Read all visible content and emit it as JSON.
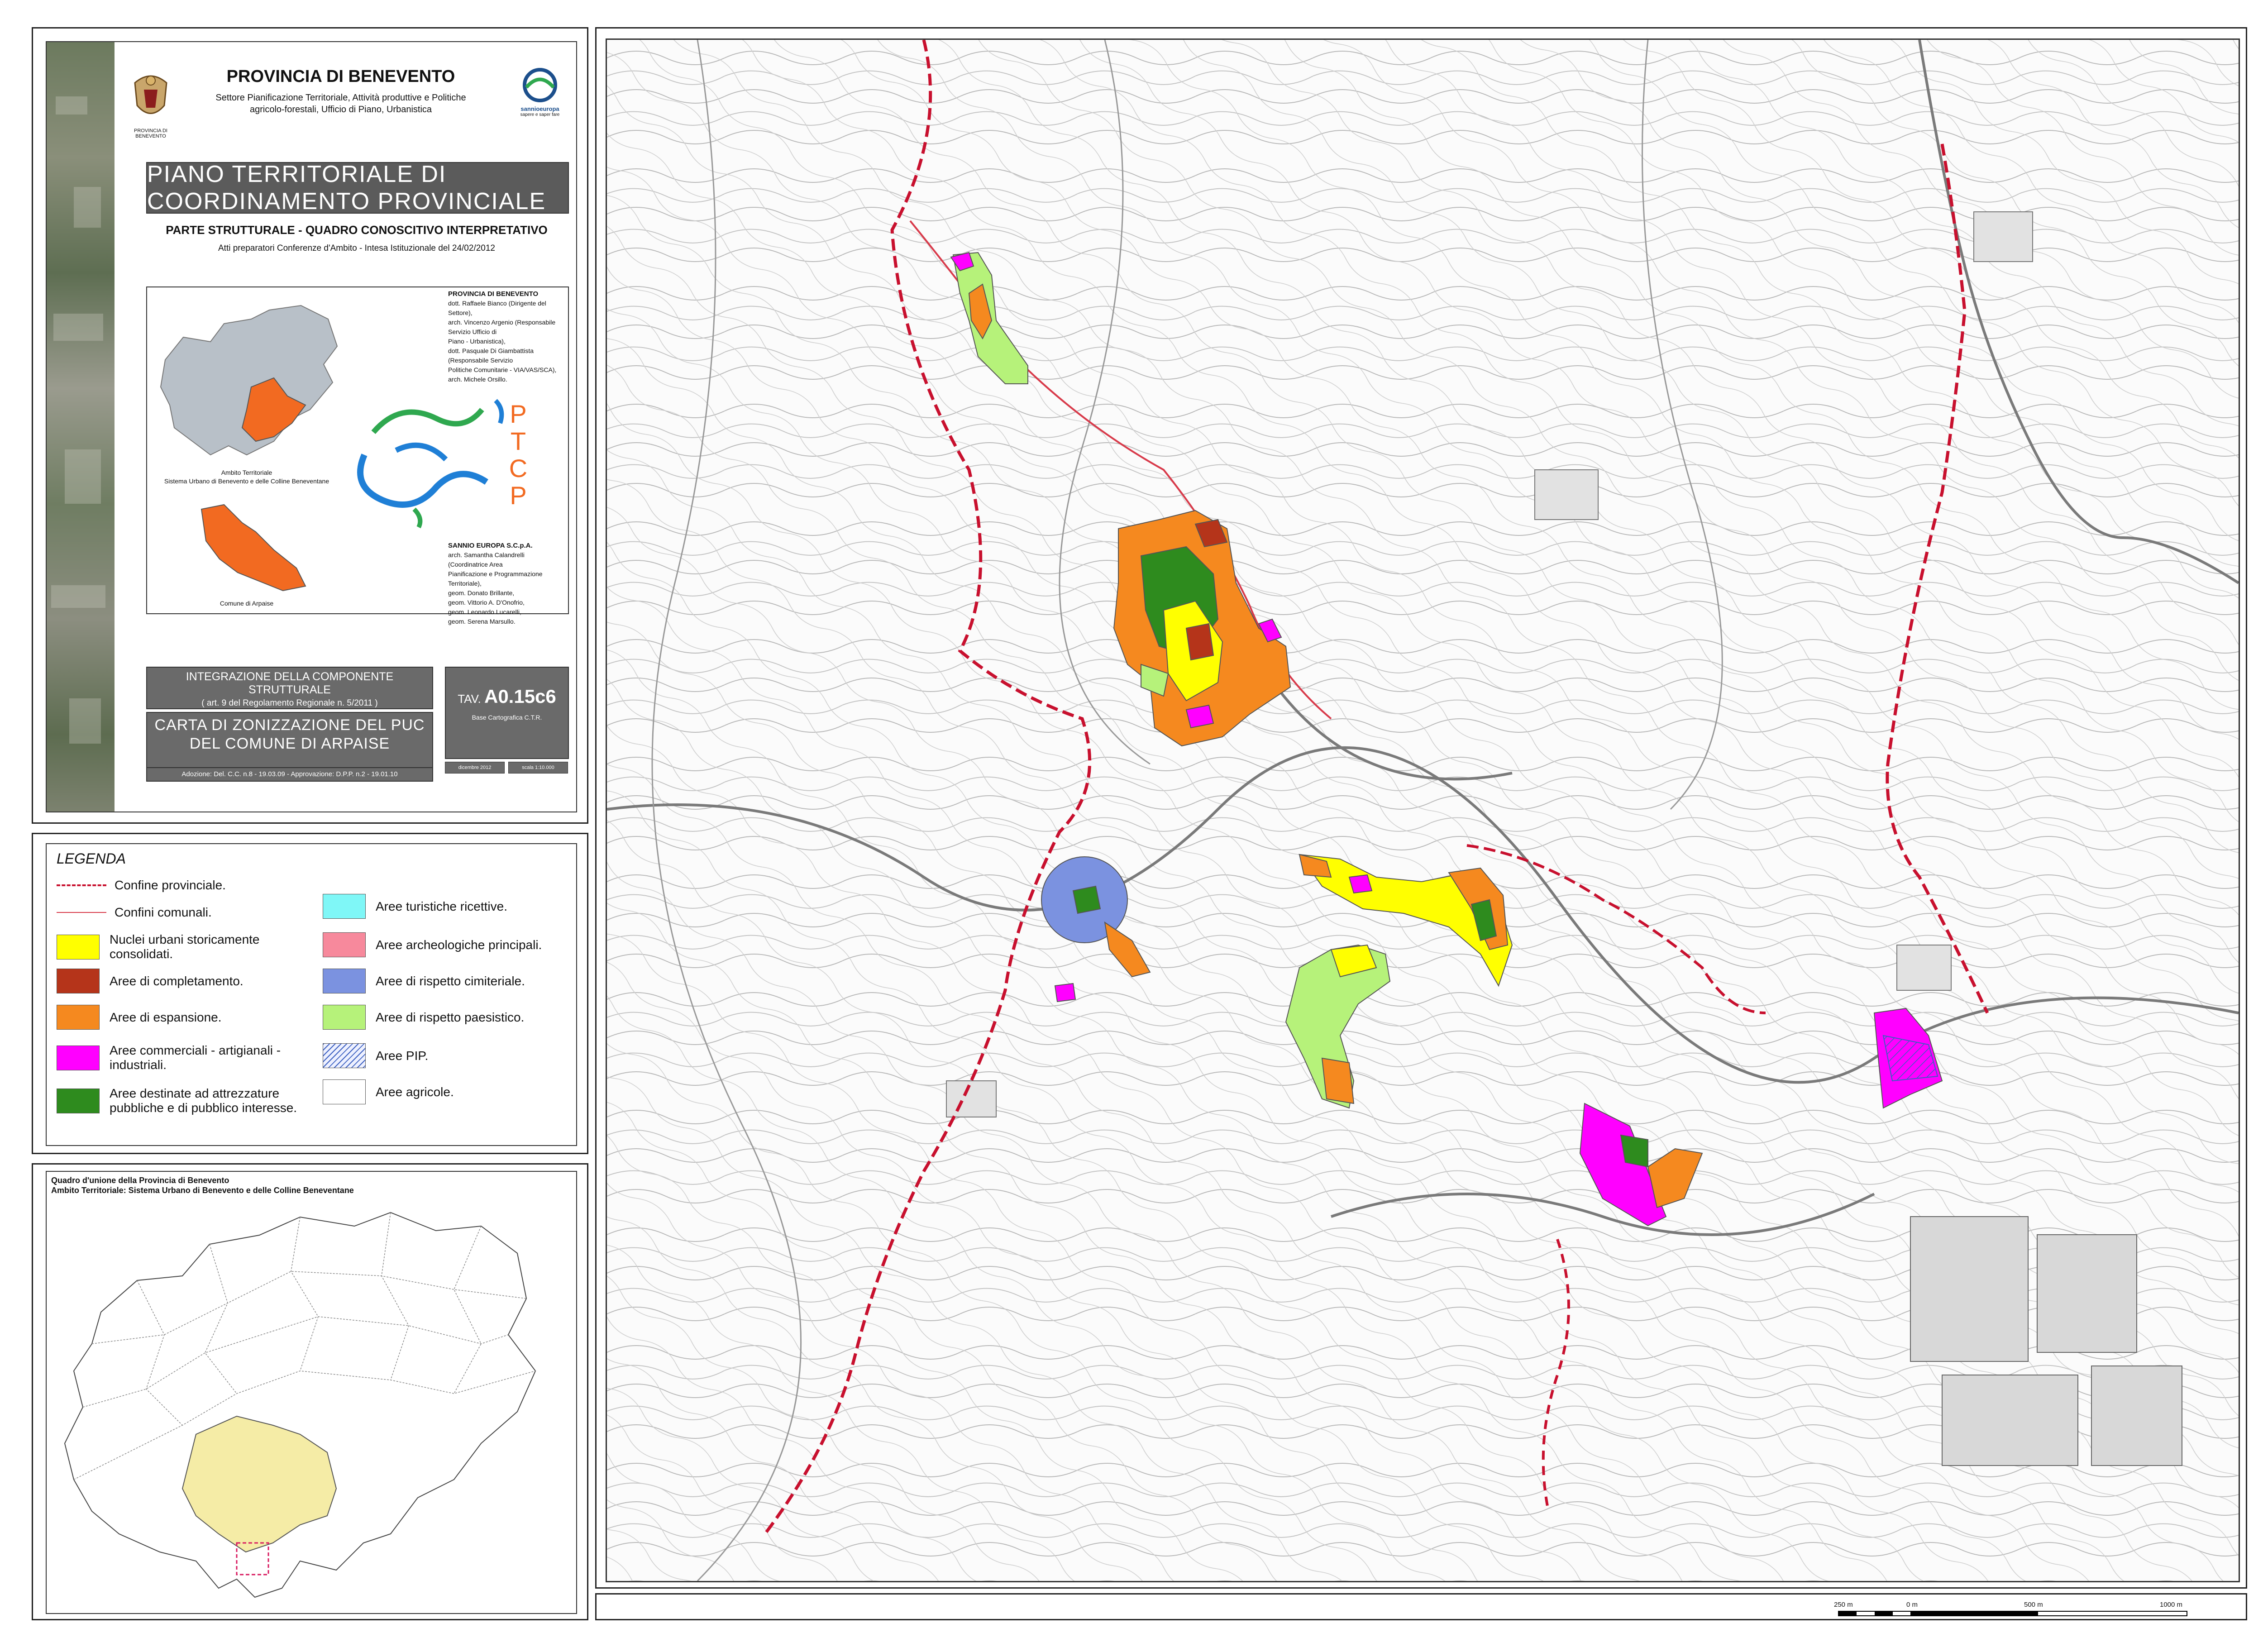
{
  "header": {
    "province": "PROVINCIA DI BENEVENTO",
    "settore_line1": "Settore Pianificazione Territoriale, Attività produttive e Politiche",
    "settore_line2": "agricolo-forestali, Ufficio di Piano, Urbanistica",
    "crest_label": "PROVINCIA DI BENEVENTO",
    "sannio_logo_name": "sannioeuropa",
    "sannio_logo_tagline": "sapere e saper fare"
  },
  "plan": {
    "banner": "PIANO TERRITORIALE DI COORDINAMENTO PROVINCIALE",
    "parte": "PARTE STRUTTURALE - QUADRO CONOSCITIVO INTERPRETATIVO",
    "atti": "Atti preparatori Conferenze d'Ambito - Intesa Istituzionale del 24/02/2012"
  },
  "credits": {
    "org1": "PROVINCIA DI BENEVENTO",
    "people1": [
      "dott. Raffaele Bianco (Dirigente del Settore),",
      "arch. Vincenzo Argenio (Responsabile Servizio Ufficio di",
      "Piano - Urbanistica),",
      "dott. Pasquale Di Giambattista (Responsabile Servizio",
      "Politiche Comunitarie - VIA/VAS/SCA),",
      "arch. Michele Orsillo."
    ],
    "org2": "SANNIO EUROPA S.C.p.A.",
    "people2": [
      "arch. Samantha Calandrelli (Coordinatrice Area",
      "Pianificazione e Programmazione Territoriale),",
      "geom. Donato Brillante,",
      "geom. Vittorio A. D'Onofrio,",
      "geom. Leonardo Lucarelli,",
      "geom. Serena Marsullo."
    ],
    "ambito_label_1": "Ambito Territoriale",
    "ambito_label_2": "Sistema Urbano di Benevento e delle Colline Beneventane",
    "comune_label": "Comune di Arpaise",
    "ptcp_letters": [
      "P",
      "T",
      "C",
      "P"
    ]
  },
  "tavola": {
    "integrazione_1": "INTEGRAZIONE DELLA COMPONENTE STRUTTURALE",
    "integrazione_2": "( art. 9 del Regolamento Regionale n. 5/2011 )",
    "carta_1": "CARTA DI ZONIZZAZIONE DEL PUC",
    "carta_2": "DEL COMUNE DI ARPAISE",
    "adozione": "Adozione: Del. C.C. n.8 - 19.03.09 - Approvazione: D.P.P. n.2 - 19.01.10",
    "tav_prefix": "TAV.",
    "tav_code": "A0.15c6",
    "base": "Base Cartografica C.T.R.",
    "date": "dicembre 2012",
    "scale": "scala 1:10.000"
  },
  "legend": {
    "title": "LEGENDA",
    "lines": [
      {
        "label": "Confine provinciale.",
        "color": "#c8102e",
        "style": "dashed"
      },
      {
        "label": "Confini comunali.",
        "color": "#d83a4a",
        "style": "thin"
      }
    ],
    "left": [
      {
        "label": "Nuclei urbani storicamente consolidati.",
        "color": "#ffff00"
      },
      {
        "label": "Aree di completamento.",
        "color": "#b5341a"
      },
      {
        "label": "Aree di espansione.",
        "color": "#f5891f"
      },
      {
        "label": "Aree commerciali - artigianali - industriali.",
        "color": "#ff00ff"
      },
      {
        "label": "Aree destinate ad attrezzature pubbliche e di pubblico interesse.",
        "color": "#2e8b1e"
      }
    ],
    "right": [
      {
        "label": "Aree turistiche ricettive.",
        "color": "#7ff7f7"
      },
      {
        "label": "Aree archeologiche principali.",
        "color": "#f7899c"
      },
      {
        "label": "Aree di rispetto cimiteriale.",
        "color": "#7b92e0"
      },
      {
        "label": "Aree di rispetto paesistico.",
        "color": "#b6f27a"
      },
      {
        "label": "Aree PIP.",
        "color": "#cfd8ff"
      },
      {
        "label": "Aree agricole.",
        "color": "#ffffff"
      }
    ]
  },
  "overview": {
    "title_1": "Quadro d'unione della Provincia di Benevento",
    "title_2": "Ambito Territoriale: Sistema Urbano di Benevento e delle Colline Beneventane"
  },
  "map": {
    "zone_colors": {
      "storico": "#ffff00",
      "completamento": "#b5341a",
      "espansione": "#f5891f",
      "commerciale": "#ff00ff",
      "attrezzature": "#2e8b1e",
      "cimiteriale": "#7b92e0",
      "paesistico": "#b6f27a",
      "pip": "#cfd8ff"
    }
  },
  "scalebar": {
    "labels": [
      "250 m",
      "0 m",
      "500 m",
      "1000 m"
    ]
  }
}
